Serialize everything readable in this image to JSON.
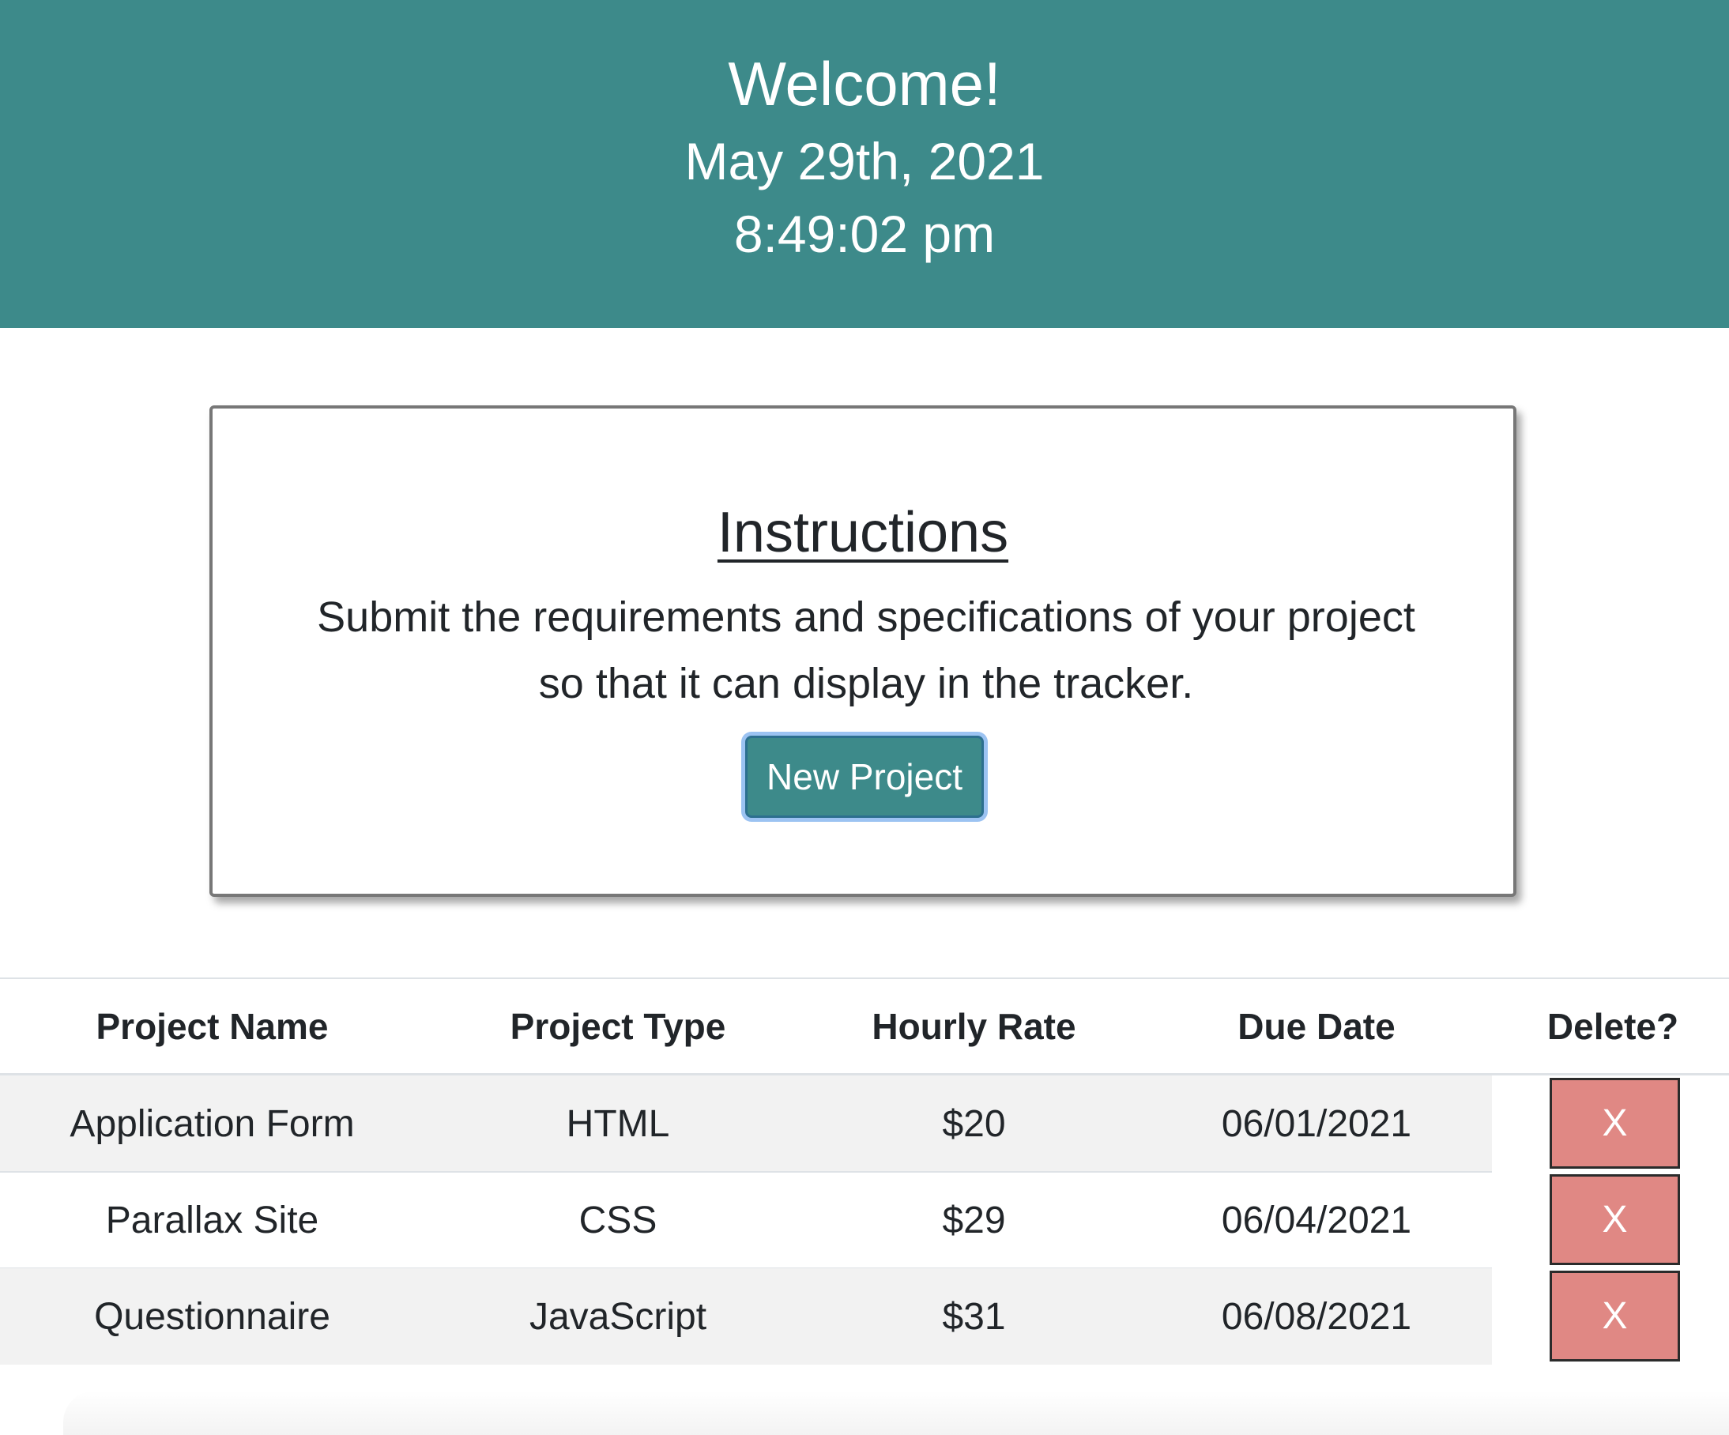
{
  "header": {
    "title": "Welcome!",
    "date": "May 29th, 2021",
    "time": "8:49:02 pm",
    "background_color": "#3d8a8a"
  },
  "instructions": {
    "title": "Instructions",
    "text": "Submit the requirements and specifications of your project so that it can display in the tracker.",
    "new_project_label": "New Project"
  },
  "table": {
    "columns": [
      "Project Name",
      "Project Type",
      "Hourly Rate",
      "Due Date",
      "Delete?"
    ],
    "rows": [
      {
        "name": "Application Form",
        "type": "HTML",
        "rate": "$20",
        "due": "06/01/2021",
        "delete_label": "X"
      },
      {
        "name": "Parallax Site",
        "type": "CSS",
        "rate": "$29",
        "due": "06/04/2021",
        "delete_label": "X"
      },
      {
        "name": "Questionnaire",
        "type": "JavaScript",
        "rate": "$31",
        "due": "06/08/2021",
        "delete_label": "X"
      }
    ],
    "delete_button_color": "#e08884"
  }
}
